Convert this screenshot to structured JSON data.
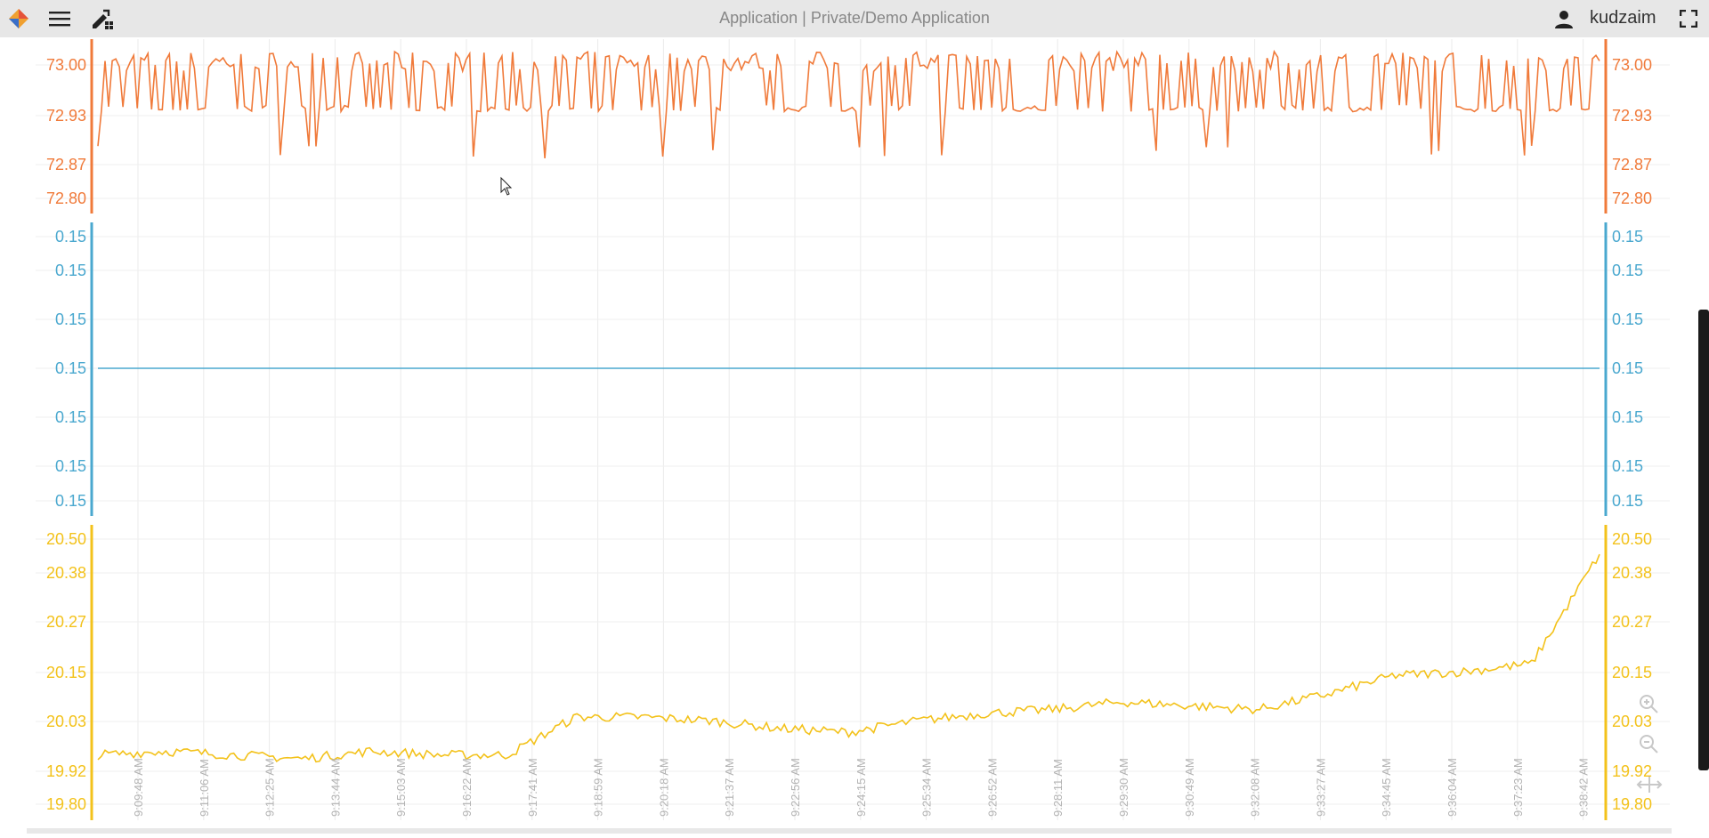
{
  "topbar": {
    "title": "Application | Private/Demo Application",
    "user": "kudzaim",
    "icons": [
      "app-logo-icon",
      "menu-icon",
      "dashboard-builder-icon",
      "user-icon",
      "fullscreen-icon"
    ]
  },
  "zoom_controls": {
    "icons": [
      "zoom-in-icon",
      "zoom-out-icon",
      "reset-zoom-icon"
    ]
  },
  "chart_data": [
    {
      "type": "line",
      "color": "#f07a3a",
      "y_ticks": [
        "73.00",
        "72.93",
        "72.87",
        "72.80"
      ],
      "ylim": [
        72.8,
        73.0
      ],
      "x_range": [
        "9:09:48 AM",
        "9:38:42 AM"
      ],
      "series": [
        {
          "pattern": "noisy oscillation between 72.93 and 73.00 with occasional dips to 72.86"
        }
      ]
    },
    {
      "type": "line",
      "color": "#4aa8cf",
      "y_ticks": [
        "0.15",
        "0.15",
        "0.15",
        "0.15",
        "0.15",
        "0.15",
        "0.15"
      ],
      "ylim": [
        0.15,
        0.15
      ],
      "series": [
        {
          "values_constant": 0.15
        }
      ]
    },
    {
      "type": "line",
      "color": "#f3c21b",
      "y_ticks": [
        "20.50",
        "20.38",
        "20.27",
        "20.15",
        "20.03",
        "19.92",
        "19.80"
      ],
      "ylim": [
        19.8,
        20.5
      ],
      "x_ticks": [
        "9:09:48 AM",
        "9:11:06 AM",
        "9:12:25 AM",
        "9:13:44 AM",
        "9:15:03 AM",
        "9:16:22 AM",
        "9:17:41 AM",
        "9:18:59 AM",
        "9:20:18 AM",
        "9:21:37 AM",
        "9:22:56 AM",
        "9:24:15 AM",
        "9:25:34 AM",
        "9:26:52 AM",
        "9:28:11 AM",
        "9:29:30 AM",
        "9:30:49 AM",
        "9:32:08 AM",
        "9:33:27 AM",
        "9:34:45 AM",
        "9:36:04 AM",
        "9:37:23 AM",
        "9:38:42 AM"
      ],
      "series": [
        {
          "x": [
            "9:09:48 AM",
            "9:11:06 AM",
            "9:12:25 AM",
            "9:13:44 AM",
            "9:15:03 AM",
            "9:16:22 AM",
            "9:17:41 AM",
            "9:18:59 AM",
            "9:20:18 AM",
            "9:21:37 AM",
            "9:22:56 AM",
            "9:24:15 AM",
            "9:25:34 AM",
            "9:26:52 AM",
            "9:28:11 AM",
            "9:29:30 AM",
            "9:30:49 AM",
            "9:32:08 AM",
            "9:33:27 AM",
            "9:34:45 AM",
            "9:36:04 AM",
            "9:37:23 AM",
            "9:38:42 AM"
          ],
          "values": [
            19.93,
            19.94,
            19.93,
            19.92,
            19.94,
            19.93,
            19.93,
            20.03,
            20.03,
            20.02,
            20.0,
            19.99,
            20.02,
            20.04,
            20.05,
            20.07,
            20.06,
            20.05,
            20.09,
            20.14,
            20.15,
            20.17,
            20.46
          ]
        }
      ]
    }
  ]
}
